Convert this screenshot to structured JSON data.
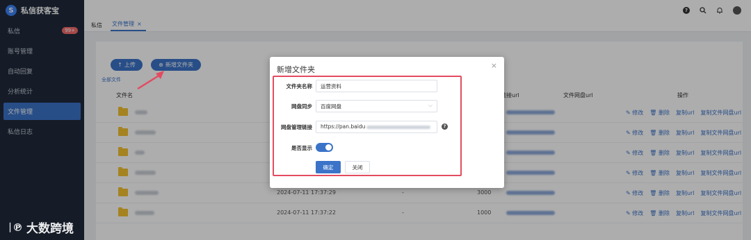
{
  "app": {
    "title": "私信获客宝"
  },
  "sidebar": {
    "items": [
      {
        "label": "私信",
        "badge": "99+"
      },
      {
        "label": "账号管理"
      },
      {
        "label": "自动回复"
      },
      {
        "label": "分析统计"
      },
      {
        "label": "文件管理"
      },
      {
        "label": "私信日志"
      }
    ]
  },
  "tabs": [
    {
      "label": "私信"
    },
    {
      "label": "文件管理",
      "close": "×"
    }
  ],
  "toolbar": {
    "upload_label": "上传",
    "new_folder_label": "新增文件夹",
    "breadcrumb": "全部文件"
  },
  "table": {
    "headers": {
      "name": "文件名",
      "link_url": "链接url",
      "disk_url": "文件网盘url",
      "ops": "操作"
    },
    "rows": [
      {
        "time": "",
        "dash": "",
        "size": ""
      },
      {
        "time": "",
        "dash": "",
        "size": ""
      },
      {
        "time": "",
        "dash": "",
        "size": ""
      },
      {
        "time": "",
        "dash": "",
        "size": ""
      },
      {
        "time": "2024-07-11 17:37:29",
        "dash": "-",
        "size": "3000"
      },
      {
        "time": "2024-07-11 17:37:22",
        "dash": "-",
        "size": "1000"
      }
    ],
    "actions": {
      "edit": "✎ 修改",
      "delete": "🗑 删除",
      "copy": "复制url",
      "copy_disk": "复制文件网盘url"
    }
  },
  "dialog": {
    "title": "新增文件夹",
    "close": "×",
    "fields": {
      "folder_name": {
        "label": "文件夹名称",
        "value": "运营资料"
      },
      "disk_sync": {
        "label": "网盘同步",
        "value": "百度网盘"
      },
      "disk_link": {
        "label": "网盘管理链接",
        "value": "https://pan.baidu"
      },
      "show": {
        "label": "是否显示"
      }
    },
    "confirm": "确定",
    "cancel": "关闭"
  },
  "watermark": {
    "logo": "ᛁ℗ ",
    "text": "大数跨境"
  },
  "colors": {
    "sidebar": "#1f2a3c",
    "accent": "#3b73c9",
    "highlight": "#e34b60"
  }
}
